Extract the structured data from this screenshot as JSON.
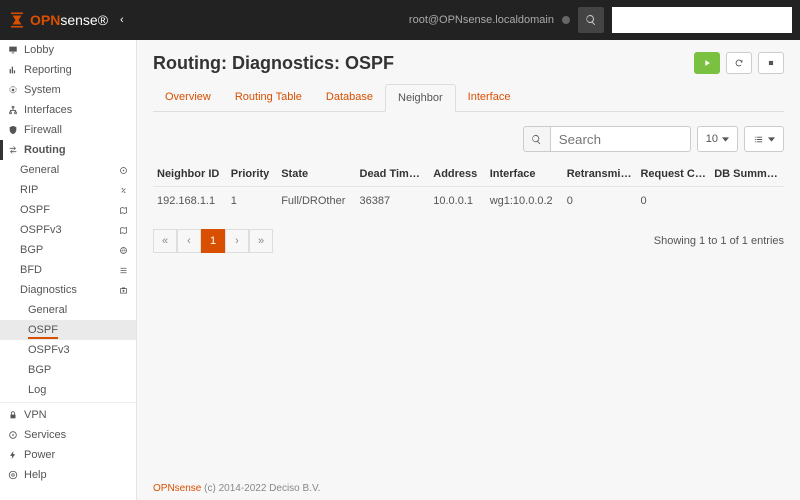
{
  "header": {
    "user": "root@OPNsense.localdomain",
    "logo1": "OPN",
    "logo2": "sense"
  },
  "search": {
    "placeholder": ""
  },
  "nav": {
    "lobby": "Lobby",
    "reporting": "Reporting",
    "system": "System",
    "interfaces": "Interfaces",
    "firewall": "Firewall",
    "routing": "Routing",
    "vpn": "VPN",
    "services": "Services",
    "power": "Power",
    "help": "Help",
    "r": {
      "general": "General",
      "rip": "RIP",
      "ospf": "OSPF",
      "ospfv3": "OSPFv3",
      "bgp": "BGP",
      "bfd": "BFD",
      "diag": "Diagnostics"
    },
    "d": {
      "general": "General",
      "ospf": "OSPF",
      "ospfv3": "OSPFv3",
      "bgp": "BGP",
      "log": "Log"
    }
  },
  "page": {
    "title": "Routing: Diagnostics: OSPF"
  },
  "tabs": {
    "overview": "Overview",
    "routing": "Routing Table",
    "database": "Database",
    "neighbor": "Neighbor",
    "interface": "Interface"
  },
  "toolbar": {
    "search_ph": "Search",
    "pagesize": "10"
  },
  "cols": {
    "id": "Neighbor ID",
    "pri": "Priority",
    "state": "State",
    "dead": "Dead Timer Due",
    "addr": "Address",
    "iface": "Interface",
    "retx": "Retransmit Counter",
    "req": "Request Counter",
    "db": "DB Summary Counter"
  },
  "row": {
    "id": "192.168.1.1",
    "pri": "1",
    "state": "Full/DROther",
    "dead": "36387",
    "addr": "10.0.0.1",
    "iface": "wg1:10.0.0.2",
    "retx": "0",
    "req": "0",
    "db": ""
  },
  "pager": {
    "p1": "1",
    "info": "Showing 1 to 1 of 1 entries"
  },
  "footer": {
    "brand": "OPNsense",
    "rest": " (c) 2014-2022 Deciso B.V."
  }
}
